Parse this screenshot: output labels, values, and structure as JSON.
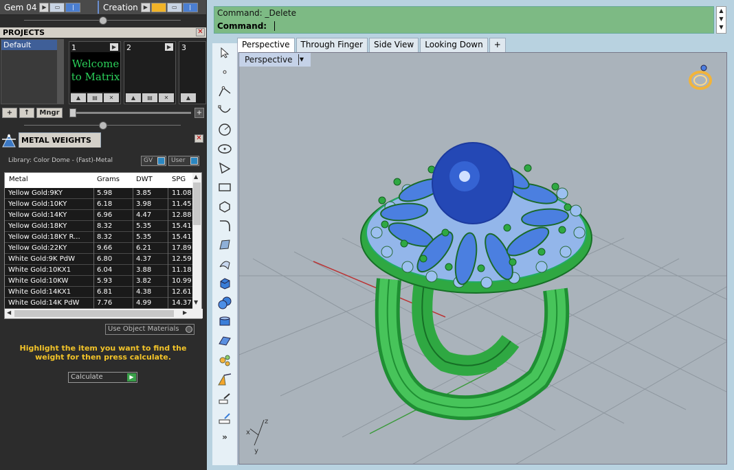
{
  "left": {
    "topbar": {
      "mode1": "Gem 04",
      "mode2": "Creation"
    },
    "projects": {
      "title": "PROJECTS",
      "list_item": "Default",
      "slots": [
        {
          "num": "1",
          "thumb_text": "Welcome to Matrix"
        },
        {
          "num": "2",
          "thumb_text": ""
        },
        {
          "num": "3",
          "thumb_text": ""
        }
      ],
      "mngr_label": "Mngr"
    },
    "metal_weights": {
      "title": "METAL WEIGHTS",
      "library": "Library: Color Dome - (Fast)-Metal",
      "gv_label": "GV",
      "user_label": "User",
      "columns": [
        "Metal",
        "Grams",
        "DWT",
        "SPG"
      ],
      "rows": [
        [
          "Yellow Gold:9KY",
          "5.98",
          "3.85",
          "11.08"
        ],
        [
          "Yellow Gold:10KY",
          "6.18",
          "3.98",
          "11.45"
        ],
        [
          "Yellow Gold:14KY",
          "6.96",
          "4.47",
          "12.88"
        ],
        [
          "Yellow Gold:18KY",
          "8.32",
          "5.35",
          "15.41"
        ],
        [
          "Yellow Gold:18KY R...",
          "8.32",
          "5.35",
          "15.41"
        ],
        [
          "Yellow Gold:22KY",
          "9.66",
          "6.21",
          "17.89"
        ],
        [
          "White Gold:9K PdW",
          "6.80",
          "4.37",
          "12.59"
        ],
        [
          "White Gold:10KX1",
          "6.04",
          "3.88",
          "11.18"
        ],
        [
          "White Gold:10KW",
          "5.93",
          "3.82",
          "10.99"
        ],
        [
          "White Gold:14KX1",
          "6.81",
          "4.38",
          "12.61"
        ],
        [
          "White Gold:14K PdW",
          "7.76",
          "4.99",
          "14.37"
        ]
      ],
      "use_object_materials": "Use Object Materials",
      "hint": "Highlight the item you want to find the weight for then press calculate.",
      "calculate_label": "Calculate"
    }
  },
  "app": {
    "command": {
      "line1": "Command: _Delete",
      "line2": "Command:"
    },
    "tabs": [
      "Perspective",
      "Through Finger",
      "Side View",
      "Looking Down"
    ],
    "add_tab": "+",
    "viewport_label": "Perspective",
    "axes": {
      "x": "x",
      "y": "y",
      "z": "z"
    },
    "colors": {
      "command_bg": "#7dba84",
      "ring": "#2fa842",
      "gem": "#5b8ae6",
      "pearl": "#1c3a9e",
      "viewport_bg": "#aab3bb"
    }
  }
}
